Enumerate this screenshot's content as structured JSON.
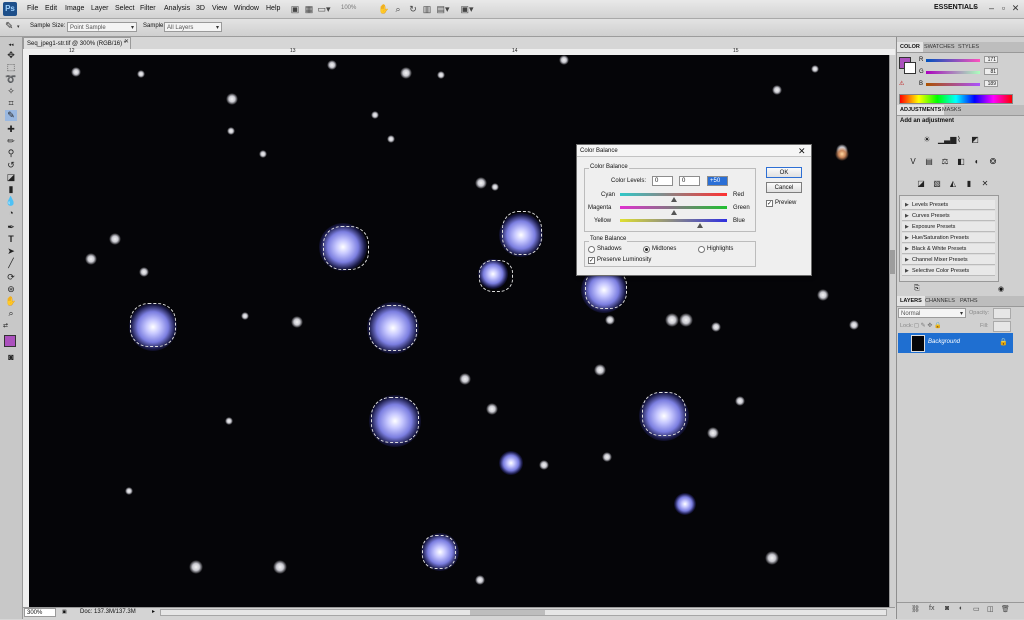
{
  "menubar": {
    "logo": "Ps",
    "menus": [
      "File",
      "Edit",
      "Image",
      "Layer",
      "Select",
      "Filter",
      "Analysis",
      "3D",
      "View",
      "Window",
      "Help"
    ],
    "zoom_value": "100%",
    "workspace": "ESSENTIALS"
  },
  "options": {
    "sample_size_label": "Sample Size:",
    "sample_size_value": "Point Sample",
    "sample_label": "Sample:",
    "sample_value": "All Layers"
  },
  "document": {
    "tab_title": "Seq_jpeg1-str.tif @ 300% (RGB/16) *",
    "ruler_marks": [
      "12",
      "13",
      "14",
      "15"
    ],
    "zoom_value": "300%",
    "doc_info": "Doc: 137.3M/137.3M"
  },
  "dialog": {
    "title": "Color Balance",
    "group_color_balance": "Color Balance",
    "color_levels_label": "Color Levels:",
    "levels": [
      "0",
      "0",
      "+50"
    ],
    "cyan": "Cyan",
    "red": "Red",
    "magenta": "Magenta",
    "green": "Green",
    "yellow": "Yellow",
    "blue": "Blue",
    "slider_positions": [
      0.5,
      0.5,
      0.75
    ],
    "group_tone_balance": "Tone Balance",
    "shadows": "Shadows",
    "midtones": "Midtones",
    "highlights": "Highlights",
    "selected_tone": "Midtones",
    "preserve_luminosity": "Preserve Luminosity",
    "preserve_checked": true,
    "ok": "OK",
    "cancel": "Cancel",
    "preview": "Preview",
    "preview_checked": true
  },
  "color_panel": {
    "tabs": [
      "COLOR",
      "SWATCHES",
      "STYLES"
    ],
    "r_label": "R",
    "g_label": "G",
    "b_label": "B",
    "r_value": "171",
    "g_value": "81",
    "b_value": "189",
    "foreground_color": "#ab51bd"
  },
  "adjustments_panel": {
    "tabs": [
      "ADJUSTMENTS",
      "MASKS"
    ],
    "heading": "Add an adjustment",
    "presets": [
      "Levels Presets",
      "Curves Presets",
      "Exposure Presets",
      "Hue/Saturation Presets",
      "Black & White Presets",
      "Channel Mixer Presets",
      "Selective Color Presets"
    ]
  },
  "layers_panel": {
    "tabs": [
      "LAYERS",
      "CHANNELS",
      "PATHS"
    ],
    "blend_mode": "Normal",
    "opacity_label": "Opacity:",
    "lock_label": "Lock:",
    "fill_label": "Fill:",
    "layer_name": "Background"
  },
  "colors": {
    "selection_blue": "#1f6fd1",
    "canvas_bg": "#050508"
  }
}
